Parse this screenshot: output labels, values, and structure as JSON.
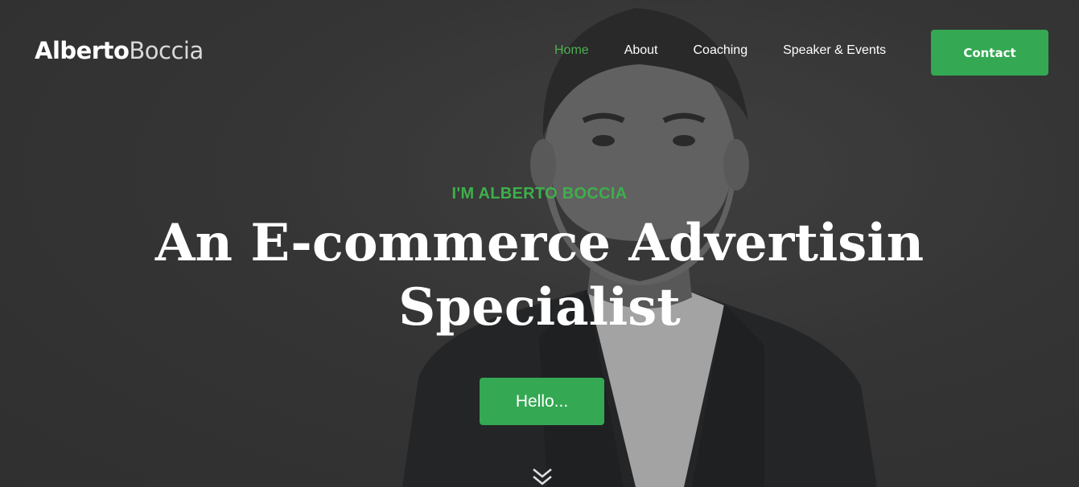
{
  "brand": {
    "first": "Alberto",
    "last": "Boccia"
  },
  "nav": {
    "items": [
      {
        "label": "Home",
        "active": true
      },
      {
        "label": "About",
        "active": false
      },
      {
        "label": "Coaching",
        "active": false
      },
      {
        "label": "Speaker & Events",
        "active": false
      }
    ],
    "contact_label": "Contact"
  },
  "hero": {
    "kicker": "I'M ALBERTO BOCCIA",
    "headline_line1": "An E-commerce Advertisin",
    "headline_line2": "Specialist",
    "cta_label": "Hello...",
    "scroll_icon": "double-chevron-down-icon"
  },
  "colors": {
    "accent": "#34a853",
    "kicker": "#3db04b",
    "background": "#3a3a3a",
    "text": "#ffffff"
  }
}
